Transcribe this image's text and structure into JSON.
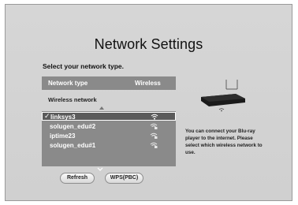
{
  "title": "Network Settings",
  "subtitle": "Select your network type.",
  "network_type": {
    "label": "Network type",
    "value": "Wireless"
  },
  "wireless_network_label": "Wireless network",
  "networks": [
    {
      "name": "linksys3",
      "selected": true,
      "icon": "wifi-icon"
    },
    {
      "name": "solugen_edu#2",
      "selected": false,
      "icon": "wifi-locked-icon"
    },
    {
      "name": "iptime23",
      "selected": false,
      "icon": "wifi-locked-icon"
    },
    {
      "name": "solugen_edu#1",
      "selected": false,
      "icon": "wifi-locked-icon"
    }
  ],
  "buttons": {
    "refresh": "Refresh",
    "wps": "WPS(PBC)"
  },
  "info_text": "You can connect your Blu-ray player to the internet. Please select which wireless network to use.",
  "colors": {
    "background": "#d2d2d2",
    "row_bg": "#8a8a8a",
    "selected_bg": "#5b5b5b"
  }
}
